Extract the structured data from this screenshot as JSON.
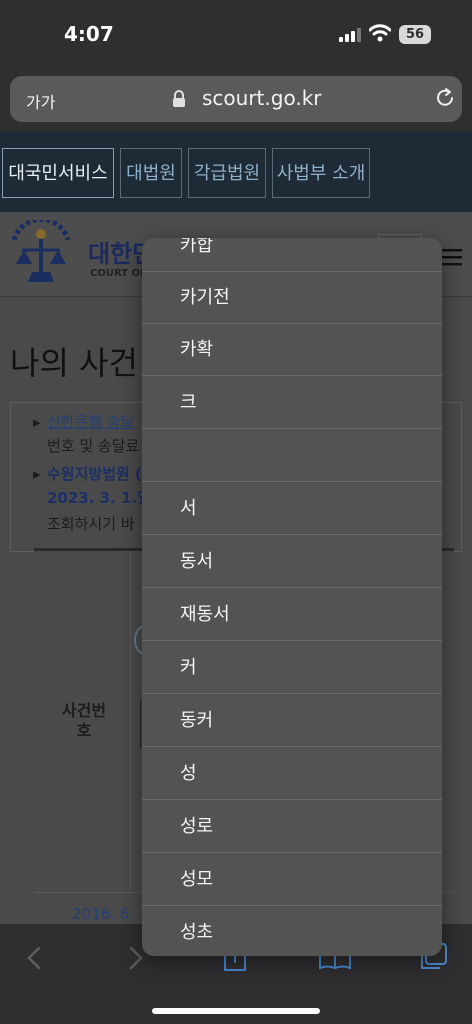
{
  "status_bar": {
    "time": "4:07",
    "battery": "56"
  },
  "address_bar": {
    "text_size_label": "가가",
    "url": "scourt.go.kr"
  },
  "site_nav": {
    "tabs": [
      {
        "label": "대국민서비스",
        "active": true
      },
      {
        "label": "대법원",
        "active": false
      },
      {
        "label": "각급법원",
        "active": false
      },
      {
        "label": "사법부 소개",
        "active": false
      }
    ]
  },
  "header": {
    "brand_visible": "대한민",
    "brand_sub_visible": "COURT OF"
  },
  "page": {
    "title_visible": "나의 사건"
  },
  "notice": {
    "line1_link": "신한은행 송달",
    "line2": "번호 및 송달료",
    "line3": "수원지방법원 (",
    "line4": "2023. 3. 1.일",
    "line5": "조회하시기 바"
  },
  "form": {
    "case_number_label_1": "사건번",
    "case_number_label_2": "호"
  },
  "bottom_notice": {
    "text": "2016. 6."
  },
  "popup": {
    "items": [
      "카합",
      "카기전",
      "카확",
      "크",
      "",
      "서",
      "동서",
      "재동서",
      "커",
      "동커",
      "성",
      "성로",
      "성모",
      "성초"
    ]
  },
  "icons": {
    "lock": "lock-icon",
    "reload": "reload-icon",
    "hamburger": "hamburger-menu-icon",
    "back": "back-arrow-icon",
    "forward": "forward-arrow-icon",
    "share": "share-icon",
    "bookmarks": "bookmarks-icon",
    "tabs": "tabs-icon"
  }
}
